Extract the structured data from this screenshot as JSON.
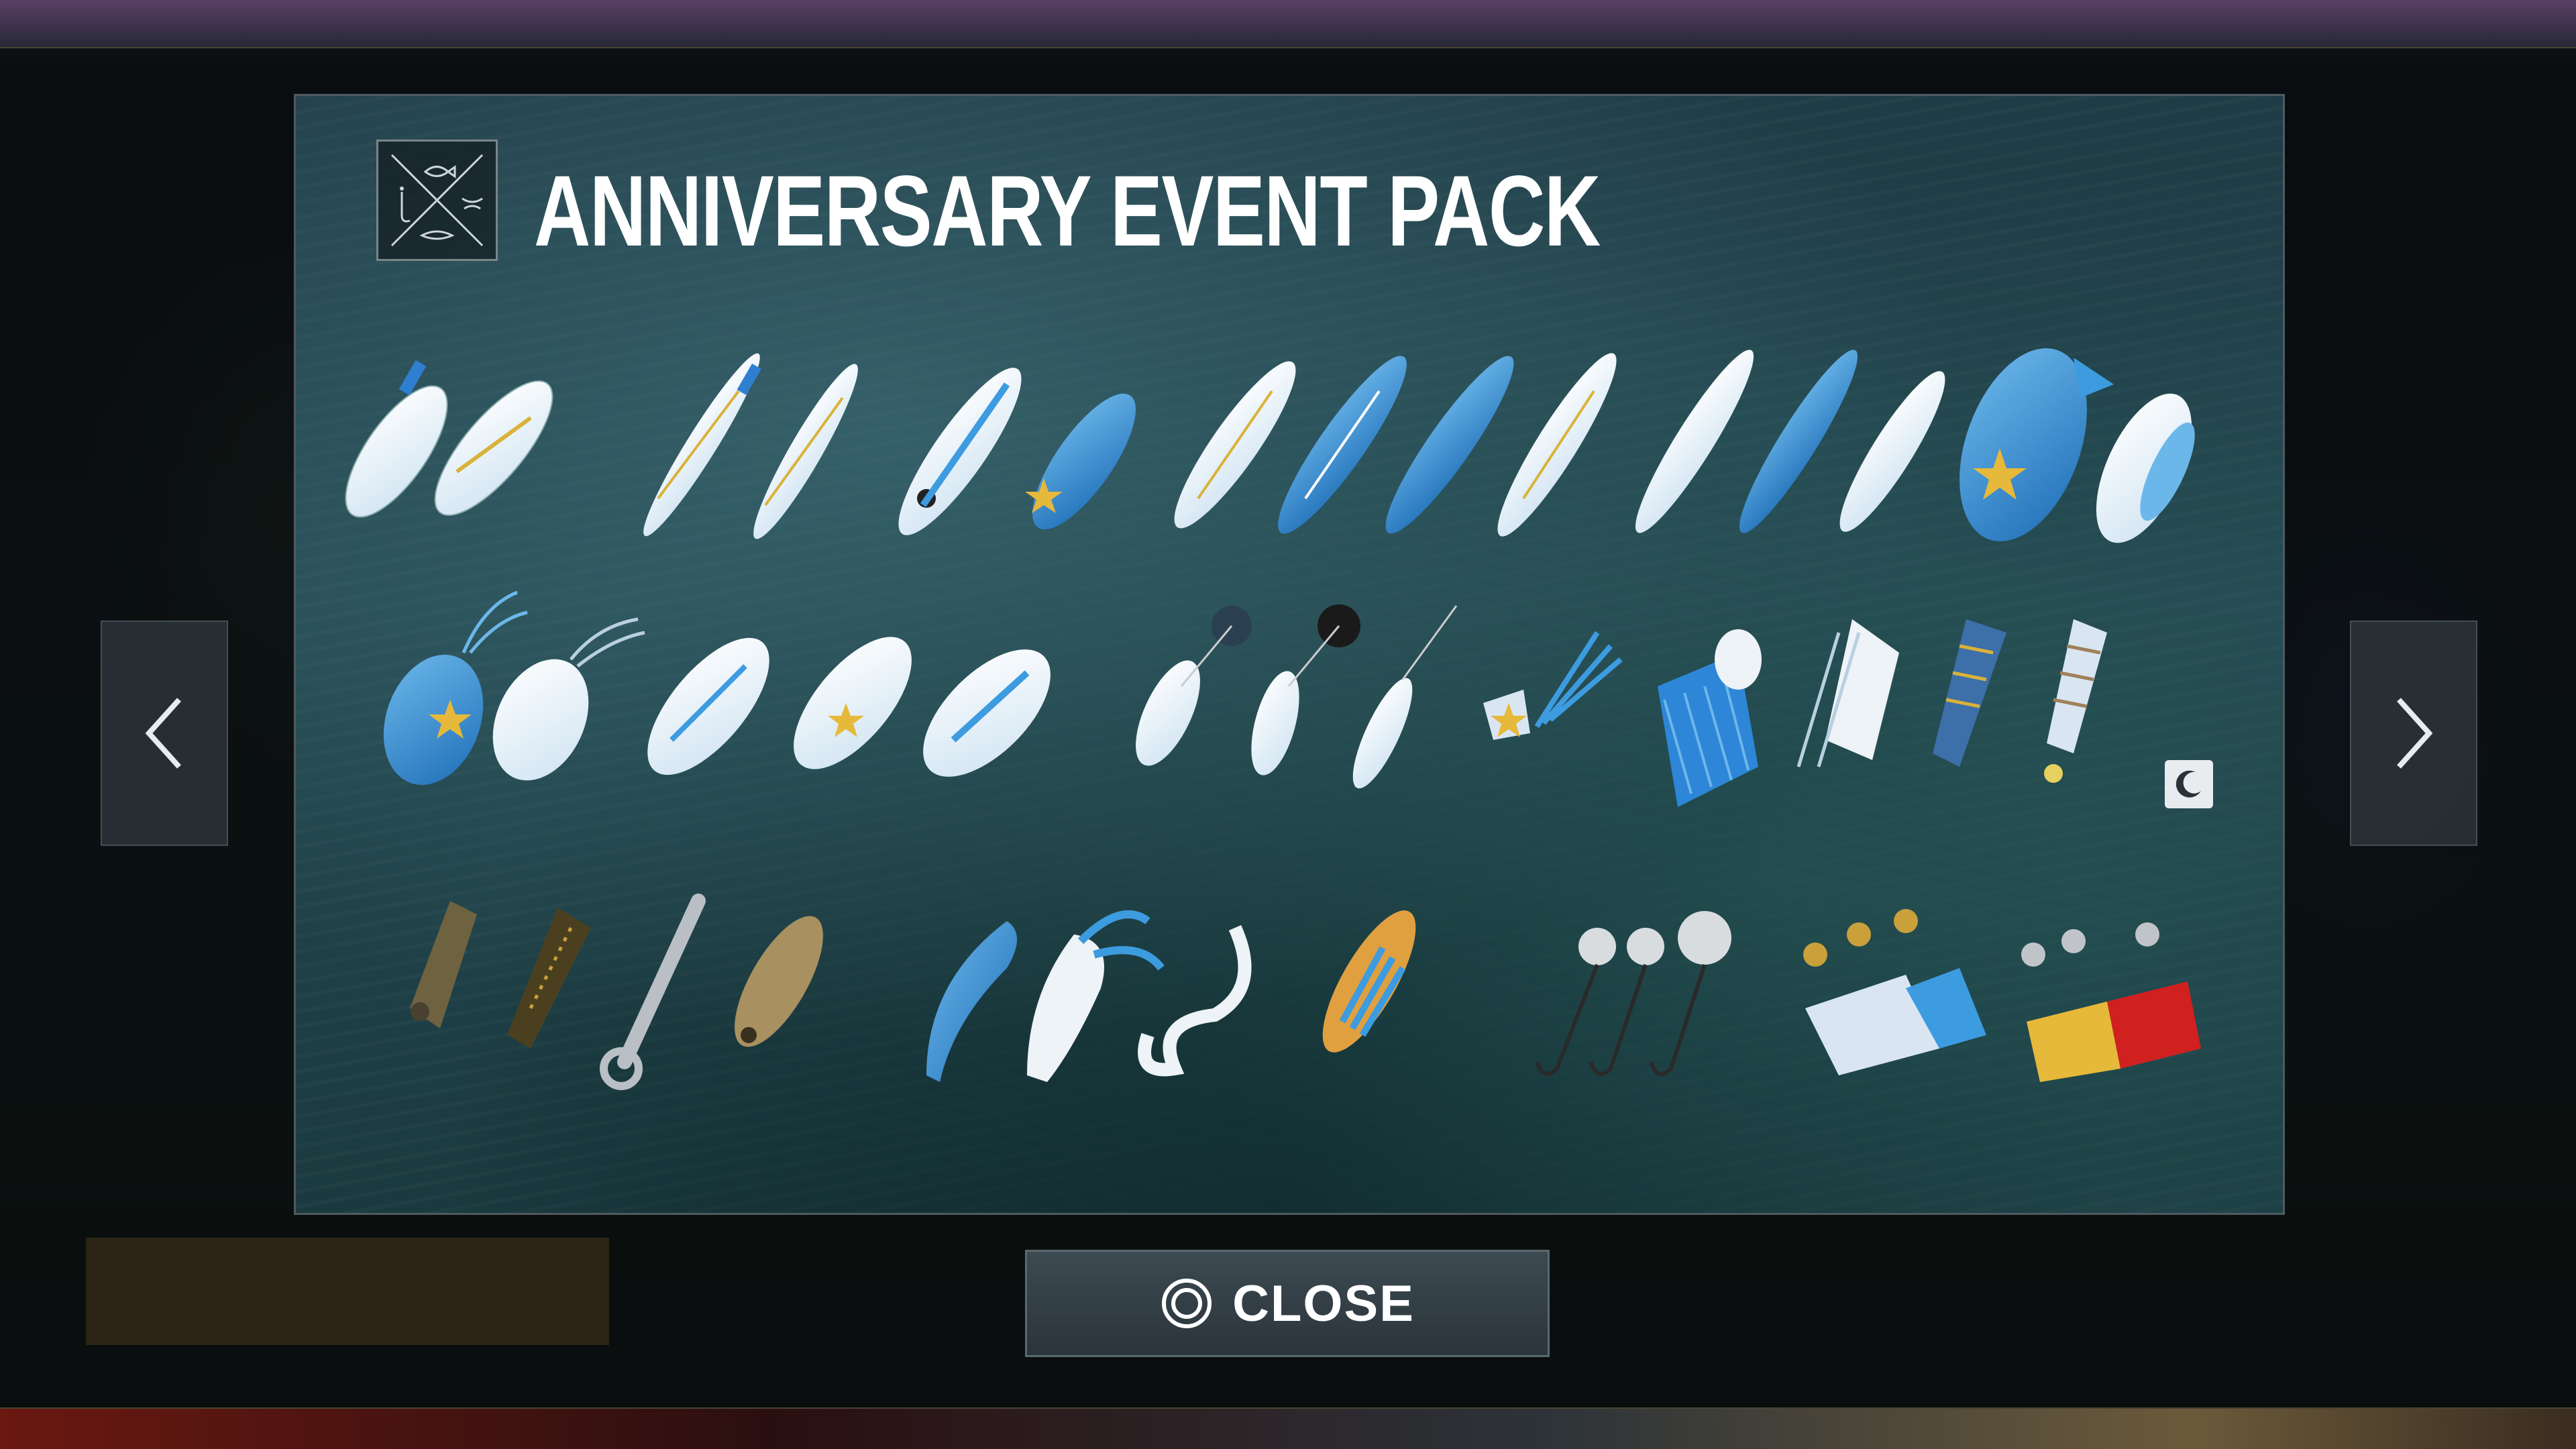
{
  "modal": {
    "title": "ANNIVERSARY EVENT PACK",
    "close_label": "CLOSE"
  },
  "icons": {
    "logo": "fishing-emblem-icon",
    "prev": "chevron-left-icon",
    "next": "chevron-right-icon",
    "close": "circle-button-icon",
    "night": "moon-icon"
  },
  "colors": {
    "accent_blue": "#3d9be0",
    "lure_white": "#eef3f7",
    "star_gold": "#e6b93a",
    "water": "#244850"
  }
}
